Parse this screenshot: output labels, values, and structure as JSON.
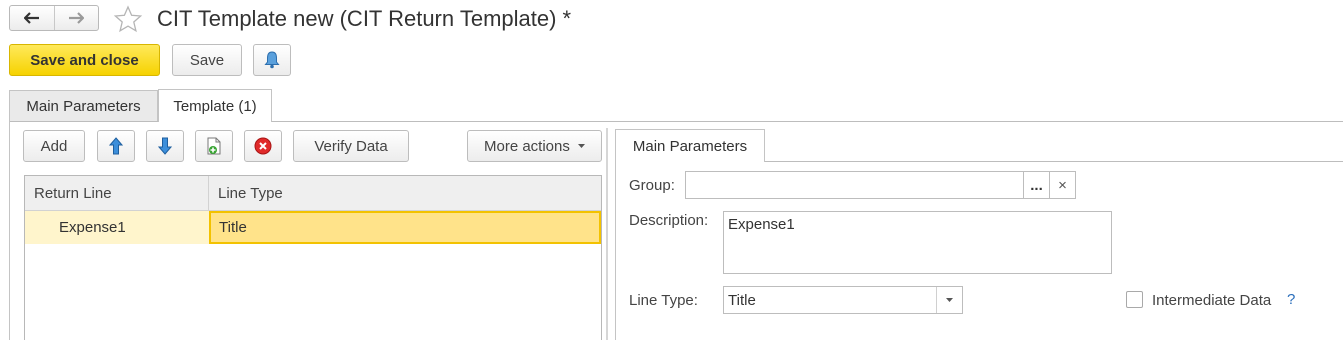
{
  "window": {
    "title": "CIT Template new (CIT Return Template) *"
  },
  "toolbar": {
    "save_and_close": "Save and close",
    "save": "Save"
  },
  "tabs": [
    {
      "label": "Main Parameters"
    },
    {
      "label": "Template (1)"
    }
  ],
  "template": {
    "add": "Add",
    "verify": "Verify Data",
    "more_actions": "More actions",
    "columns": [
      "Return Line",
      "Line Type"
    ],
    "rows": [
      {
        "return_line": "Expense1",
        "line_type": "Title"
      }
    ]
  },
  "details": {
    "tab": "Main Parameters",
    "group_label": "Group:",
    "group_value": "",
    "group_select": "...",
    "group_clear": "×",
    "description_label": "Description:",
    "description_value": "Expense1",
    "line_type_label": "Line Type:",
    "line_type_value": "Title",
    "intermediate_label": "Intermediate Data",
    "intermediate_checked": false,
    "help": "?"
  },
  "colors": {
    "primary_button": "#f6d200",
    "selected_row": "#ffe38a",
    "help_link": "#2a6ebb"
  }
}
